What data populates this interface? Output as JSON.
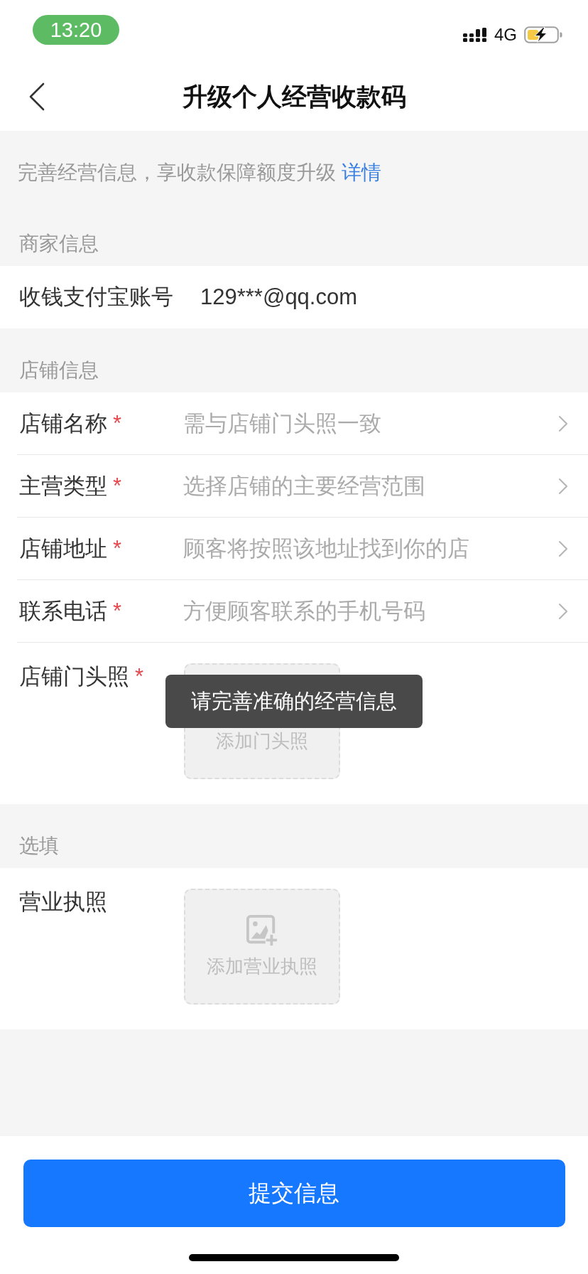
{
  "status_bar": {
    "time": "13:20",
    "network": "4G"
  },
  "nav": {
    "title": "升级个人经营收款码"
  },
  "notice": {
    "text": "完善经营信息，享收款保障额度升级",
    "link": "详情"
  },
  "sections": [
    {
      "title": "商家信息",
      "rows": [
        {
          "kind": "value",
          "label": "收钱支付宝账号",
          "value": "129***@qq.com"
        }
      ]
    },
    {
      "title": "店铺信息",
      "rows": [
        {
          "kind": "select",
          "label": "店铺名称",
          "required_mark": "*",
          "placeholder": "需与店铺门头照一致"
        },
        {
          "kind": "select",
          "label": "主营类型",
          "required_mark": "*",
          "placeholder": "选择店铺的主要经营范围"
        },
        {
          "kind": "select",
          "label": "店铺地址",
          "required_mark": "*",
          "placeholder": "顾客将按照该地址找到你的店"
        },
        {
          "kind": "select",
          "label": "联系电话",
          "required_mark": "*",
          "placeholder": "方便顾客联系的手机号码"
        },
        {
          "kind": "upload",
          "label": "店铺门头照",
          "required_mark": "*",
          "upload_text": "添加门头照"
        }
      ]
    },
    {
      "title": "选填",
      "rows": [
        {
          "kind": "upload",
          "label": "营业执照",
          "upload_text": "添加营业执照"
        }
      ]
    }
  ],
  "toast": {
    "text": "请完善准确的经营信息"
  },
  "submit_button": {
    "label": "提交信息"
  }
}
